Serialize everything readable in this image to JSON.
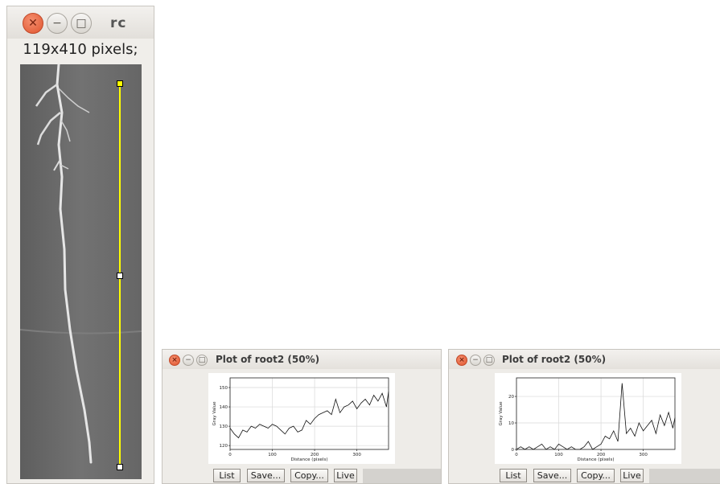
{
  "image_window": {
    "title_partial": "rc",
    "info": "119x410 pixels;",
    "buttons": {
      "close_glyph": "✕",
      "minimize_glyph": "−",
      "maximize_glyph": "□"
    },
    "line_selection_color": "#ffff00"
  },
  "plot_windows": [
    {
      "title": "Plot of root2 (50%)",
      "buttons": [
        "List",
        "Save...",
        "Copy...",
        "Live"
      ],
      "chart_data": {
        "type": "line",
        "xlabel": "Distance (pixels)",
        "ylabel": "Gray Value",
        "xlim": [
          0,
          375
        ],
        "ylim": [
          118,
          155
        ],
        "xticks": [
          0,
          100,
          200,
          300
        ],
        "yticks": [
          120,
          130,
          140,
          150
        ],
        "grid": true,
        "series": [
          {
            "x": [
              0,
              10,
              20,
              30,
              40,
              50,
              60,
              70,
              80,
              90,
              100,
              110,
              120,
              130,
              140,
              150,
              160,
              170,
              180,
              190,
              200,
              210,
              220,
              230,
              240,
              250,
              260,
              270,
              280,
              290,
              300,
              310,
              320,
              330,
              340,
              350,
              360,
              370,
              375
            ],
            "y": [
              129,
              126,
              124,
              128,
              127,
              130,
              129,
              131,
              130,
              129,
              131,
              130,
              128,
              126,
              129,
              130,
              127,
              128,
              133,
              131,
              134,
              136,
              137,
              138,
              136,
              144,
              137,
              140,
              141,
              143,
              139,
              142,
              144,
              141,
              146,
              143,
              147,
              140,
              148
            ]
          }
        ]
      }
    },
    {
      "title": "Plot of root2 (50%)",
      "buttons": [
        "List",
        "Save...",
        "Copy...",
        "Live"
      ],
      "chart_data": {
        "type": "line",
        "xlabel": "Distance (pixels)",
        "ylabel": "Gray Value",
        "xlim": [
          0,
          375
        ],
        "ylim": [
          0,
          27
        ],
        "xticks": [
          0,
          100,
          200,
          300
        ],
        "yticks": [
          0,
          10,
          20
        ],
        "grid": true,
        "series": [
          {
            "x": [
              0,
              10,
              20,
              30,
              40,
              50,
              60,
              70,
              80,
              90,
              100,
              110,
              120,
              130,
              140,
              150,
              160,
              170,
              180,
              190,
              200,
              210,
              220,
              230,
              240,
              250,
              260,
              270,
              280,
              290,
              300,
              310,
              320,
              330,
              340,
              350,
              360,
              370,
              375
            ],
            "y": [
              0,
              1,
              0,
              1,
              0,
              1,
              2,
              0,
              1,
              0,
              2,
              1,
              0,
              1,
              0,
              0,
              1,
              3,
              0,
              1,
              2,
              5,
              4,
              7,
              3,
              25,
              6,
              8,
              5,
              10,
              7,
              9,
              11,
              6,
              13,
              9,
              14,
              8,
              12
            ]
          }
        ]
      }
    }
  ]
}
